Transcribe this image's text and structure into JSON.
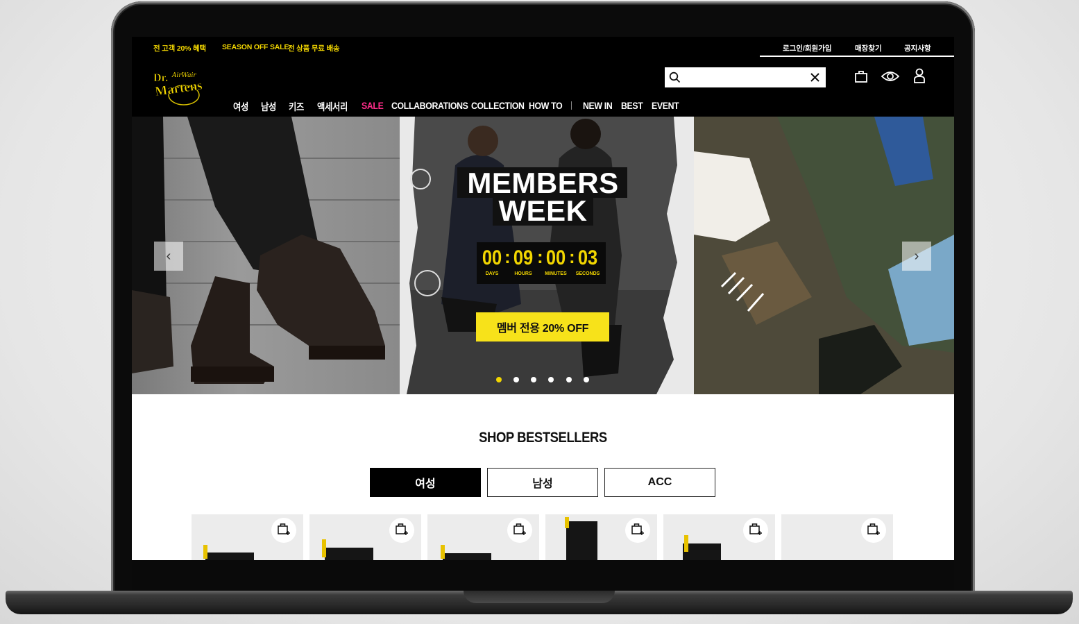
{
  "promo_bar": {
    "items": [
      "전 고객 20% 혜택",
      "SEASON OFF SALE",
      "전 상품 무료 배송"
    ],
    "util_links": [
      "로그인/회원가입",
      "매장찾기",
      "공지사항"
    ]
  },
  "header": {
    "logo_text": "Dr. Martens AirWair",
    "search": {
      "value": "",
      "placeholder": ""
    },
    "icons": [
      "search-icon",
      "clear-icon",
      "bag-icon",
      "eye-icon",
      "user-icon"
    ]
  },
  "nav": {
    "items": [
      "여성",
      "남성",
      "키즈",
      "액세서리",
      "SALE",
      "COLLABORATIONS",
      "COLLECTION",
      "HOW TO",
      "NEW IN",
      "BEST",
      "EVENT"
    ]
  },
  "hero": {
    "title_line1": "MEMBERS",
    "title_line2": "WEEK",
    "countdown": {
      "days": "00",
      "hours": "09",
      "minutes": "00",
      "seconds": "03",
      "labels": [
        "DAYS",
        "HOURS",
        "MINUTES",
        "SECONDS"
      ]
    },
    "cta": "멤버 전용 20% OFF",
    "slides_count": 6,
    "active_slide": 1,
    "prev_label": "‹",
    "next_label": "›"
  },
  "bestsellers": {
    "title": "SHOP BESTSELLERS",
    "tabs": [
      "여성",
      "남성",
      "ACC"
    ],
    "active_tab": 0,
    "product_count": 6
  },
  "colors": {
    "accent_yellow": "#f2d600",
    "sale_pink": "#ff2d8a",
    "background": "#000000"
  }
}
